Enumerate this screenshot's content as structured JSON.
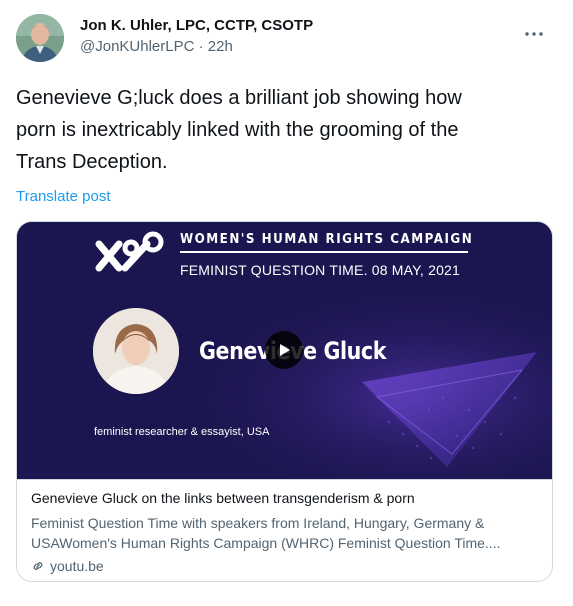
{
  "author": {
    "name": "Jon K. Uhler, LPC, CCTP, CSOTP",
    "handle": "@JonKUhlerLPC",
    "separator": "·",
    "time": "22h"
  },
  "post": {
    "text_line1": "Genevieve G;luck does a brilliant job showing how",
    "text_line2": "porn is inextricably linked with the grooming of the",
    "text_line3": "Trans Deception.",
    "translate_label": "Translate post"
  },
  "card": {
    "media": {
      "org_name": "WOMEN'S HUMAN RIGHTS CAMPAIGN",
      "event_line": "FEMINIST QUESTION TIME. 08 MAY, 2021",
      "speaker_name": "Genevieve Gluck",
      "speaker_role": "feminist researcher & essayist, USA",
      "bg_color": "#1c1650",
      "accent_color": "#6b3fc9"
    },
    "title": "Genevieve Gluck on the links between transgenderism & porn",
    "description_line1": "Feminist Question Time with speakers from Ireland, Hungary, Germany &",
    "description_line2": "USAWomen's Human Rights Campaign (WHRC) Feminist Question Time....",
    "domain": "youtu.be"
  },
  "icons": {
    "more": "more-horizontal-icon",
    "play": "play-icon",
    "link": "link-icon"
  },
  "colors": {
    "link_blue": "#1d9bf0",
    "secondary_text": "#536471",
    "border": "#cfd9de"
  }
}
